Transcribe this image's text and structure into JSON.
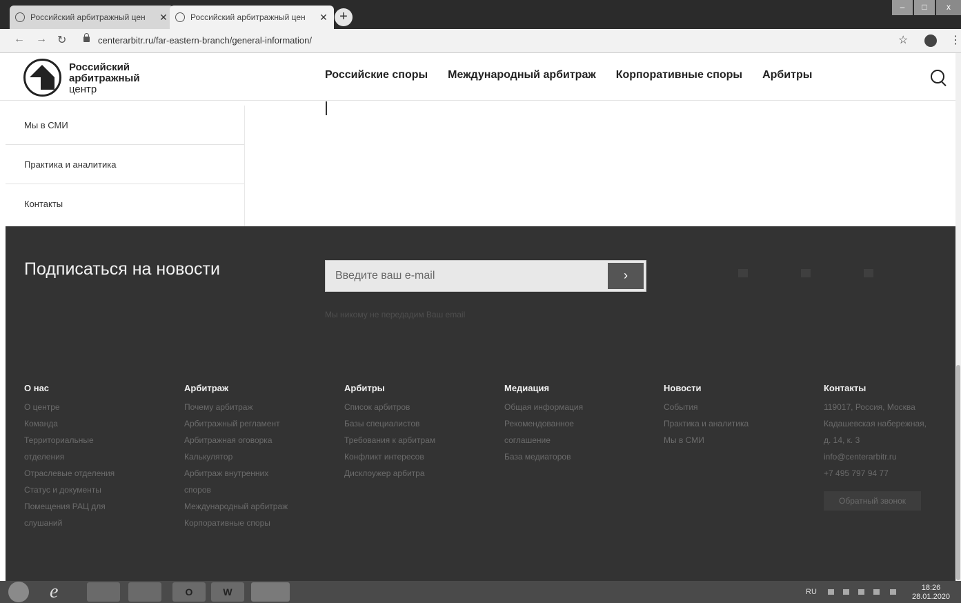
{
  "browser": {
    "tabs": [
      {
        "title": "Российский арбитражный цен",
        "active": false
      },
      {
        "title": "Российский арбитражный цен",
        "active": true
      }
    ],
    "new_tab": "+",
    "url": "centerarbitr.ru/far-eastern-branch/general-information/",
    "window_controls": {
      "minimize": "–",
      "maximize": "□",
      "close": "x"
    }
  },
  "site": {
    "brand": {
      "line1": "Российский",
      "line2": "арбитражный",
      "line3": "центр"
    },
    "nav": [
      "Российские споры",
      "Международный арбитраж",
      "Корпоративные споры",
      "Арбитры"
    ]
  },
  "sidebar": {
    "items": [
      {
        "label": "Мы в СМИ"
      },
      {
        "label": "Практика и аналитика"
      },
      {
        "label": "Контакты"
      }
    ]
  },
  "footer": {
    "subscribe_title": "Подписаться на новости",
    "email_placeholder": "Введите ваш e-mail",
    "send_glyph": "›",
    "privacy_note": "Мы никому не передадим Ваш email",
    "columns": [
      {
        "heading": "О нас",
        "links": [
          "О центре",
          "Команда",
          "Территориальные",
          "отделения",
          "Отраслевые отделения",
          "Статус и документы",
          "Помещения РАЦ для",
          "слушаний"
        ]
      },
      {
        "heading": "Арбитраж",
        "links": [
          "Почему арбитраж",
          "Арбитражный регламент",
          "Арбитражная оговорка",
          "Калькулятор",
          "Арбитраж внутренних",
          "споров",
          "Международный арбитраж",
          "Корпоративные споры"
        ]
      },
      {
        "heading": "Арбитры",
        "links": [
          "Список арбитров",
          "Базы специалистов",
          "Требования к арбитрам",
          "Конфликт интересов",
          "Дисклоужер арбитра"
        ]
      },
      {
        "heading": "Медиация",
        "links": [
          "Общая информация",
          "Рекомендованное",
          "соглашение",
          "База медиаторов"
        ]
      },
      {
        "heading": "Новости",
        "links": [
          "События",
          "Практика и аналитика",
          "Мы в СМИ"
        ]
      },
      {
        "heading": "Контакты",
        "links": [
          "119017, Россия, Москва",
          "Кадашевская набережная,",
          "д. 14, к. 3",
          "info@centerarbitr.ru",
          "+7 495 797 94 77"
        ],
        "button": "Обратный звонок"
      }
    ]
  },
  "taskbar": {
    "apps": [
      "",
      "",
      "O",
      "W",
      ""
    ],
    "language": "RU",
    "time": "18:26",
    "date": "28.01.2020"
  }
}
